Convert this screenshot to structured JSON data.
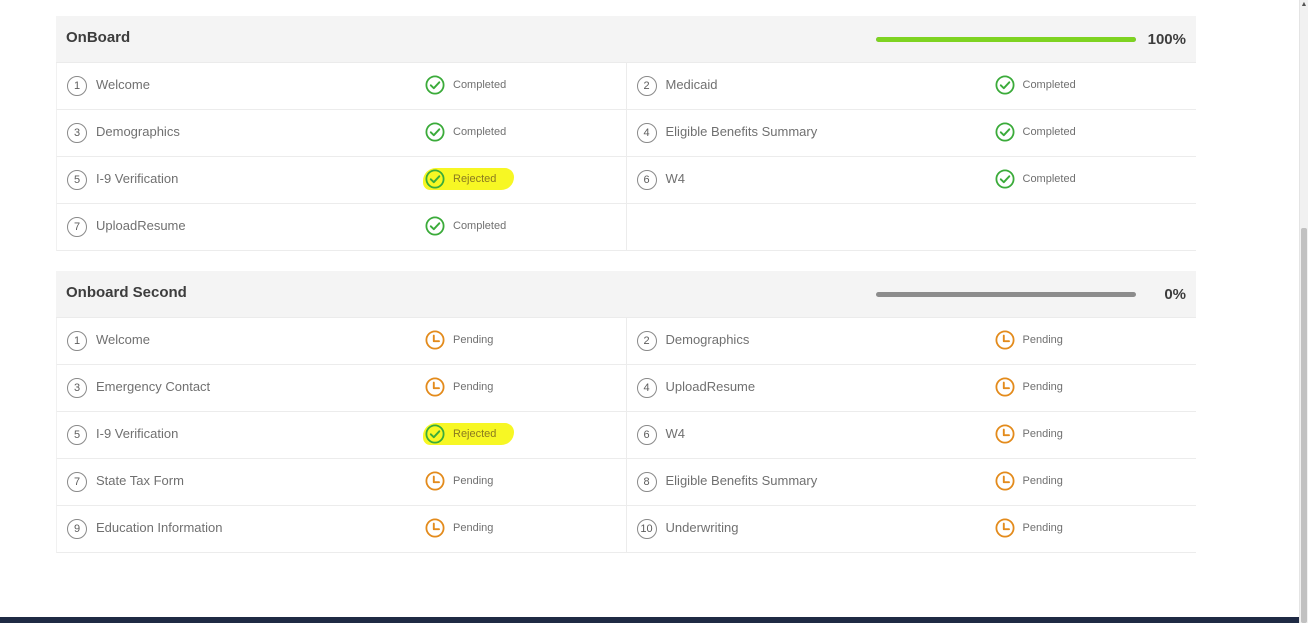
{
  "colors": {
    "completed": "#3bab3a",
    "pending": "#e38b1c",
    "progress_fill": "#7ed321",
    "progress_track": "#8c8c8c",
    "highlight": "#f7f724",
    "footer": "#1f2a44"
  },
  "icons": {
    "completed": "check-circle-icon",
    "pending": "clock-icon"
  },
  "sections": [
    {
      "title": "OnBoard",
      "progress_value": 100,
      "progress_label": "100%",
      "rows": [
        [
          {
            "num": "1",
            "name": "Welcome",
            "status": "Completed",
            "icon": "completed",
            "highlight": false
          },
          {
            "num": "2",
            "name": "Medicaid",
            "status": "Completed",
            "icon": "completed",
            "highlight": false
          }
        ],
        [
          {
            "num": "3",
            "name": "Demographics",
            "status": "Completed",
            "icon": "completed",
            "highlight": false
          },
          {
            "num": "4",
            "name": "Eligible Benefits Summary",
            "status": "Completed",
            "icon": "completed",
            "highlight": false
          }
        ],
        [
          {
            "num": "5",
            "name": "I-9 Verification",
            "status": "Rejected",
            "icon": "completed",
            "highlight": true
          },
          {
            "num": "6",
            "name": "W4",
            "status": "Completed",
            "icon": "completed",
            "highlight": false
          }
        ],
        [
          {
            "num": "7",
            "name": "UploadResume",
            "status": "Completed",
            "icon": "completed",
            "highlight": false
          },
          null
        ]
      ]
    },
    {
      "title": "Onboard Second",
      "progress_value": 0,
      "progress_label": "0%",
      "rows": [
        [
          {
            "num": "1",
            "name": "Welcome",
            "status": "Pending",
            "icon": "pending",
            "highlight": false
          },
          {
            "num": "2",
            "name": "Demographics",
            "status": "Pending",
            "icon": "pending",
            "highlight": false
          }
        ],
        [
          {
            "num": "3",
            "name": "Emergency Contact",
            "status": "Pending",
            "icon": "pending",
            "highlight": false
          },
          {
            "num": "4",
            "name": "UploadResume",
            "status": "Pending",
            "icon": "pending",
            "highlight": false
          }
        ],
        [
          {
            "num": "5",
            "name": "I-9 Verification",
            "status": "Rejected",
            "icon": "completed",
            "highlight": true
          },
          {
            "num": "6",
            "name": "W4",
            "status": "Pending",
            "icon": "pending",
            "highlight": false
          }
        ],
        [
          {
            "num": "7",
            "name": "State Tax Form",
            "status": "Pending",
            "icon": "pending",
            "highlight": false
          },
          {
            "num": "8",
            "name": "Eligible Benefits Summary",
            "status": "Pending",
            "icon": "pending",
            "highlight": false
          }
        ],
        [
          {
            "num": "9",
            "name": "Education Information",
            "status": "Pending",
            "icon": "pending",
            "highlight": false
          },
          {
            "num": "10",
            "name": "Underwriting",
            "status": "Pending",
            "icon": "pending",
            "highlight": false
          }
        ]
      ]
    }
  ]
}
